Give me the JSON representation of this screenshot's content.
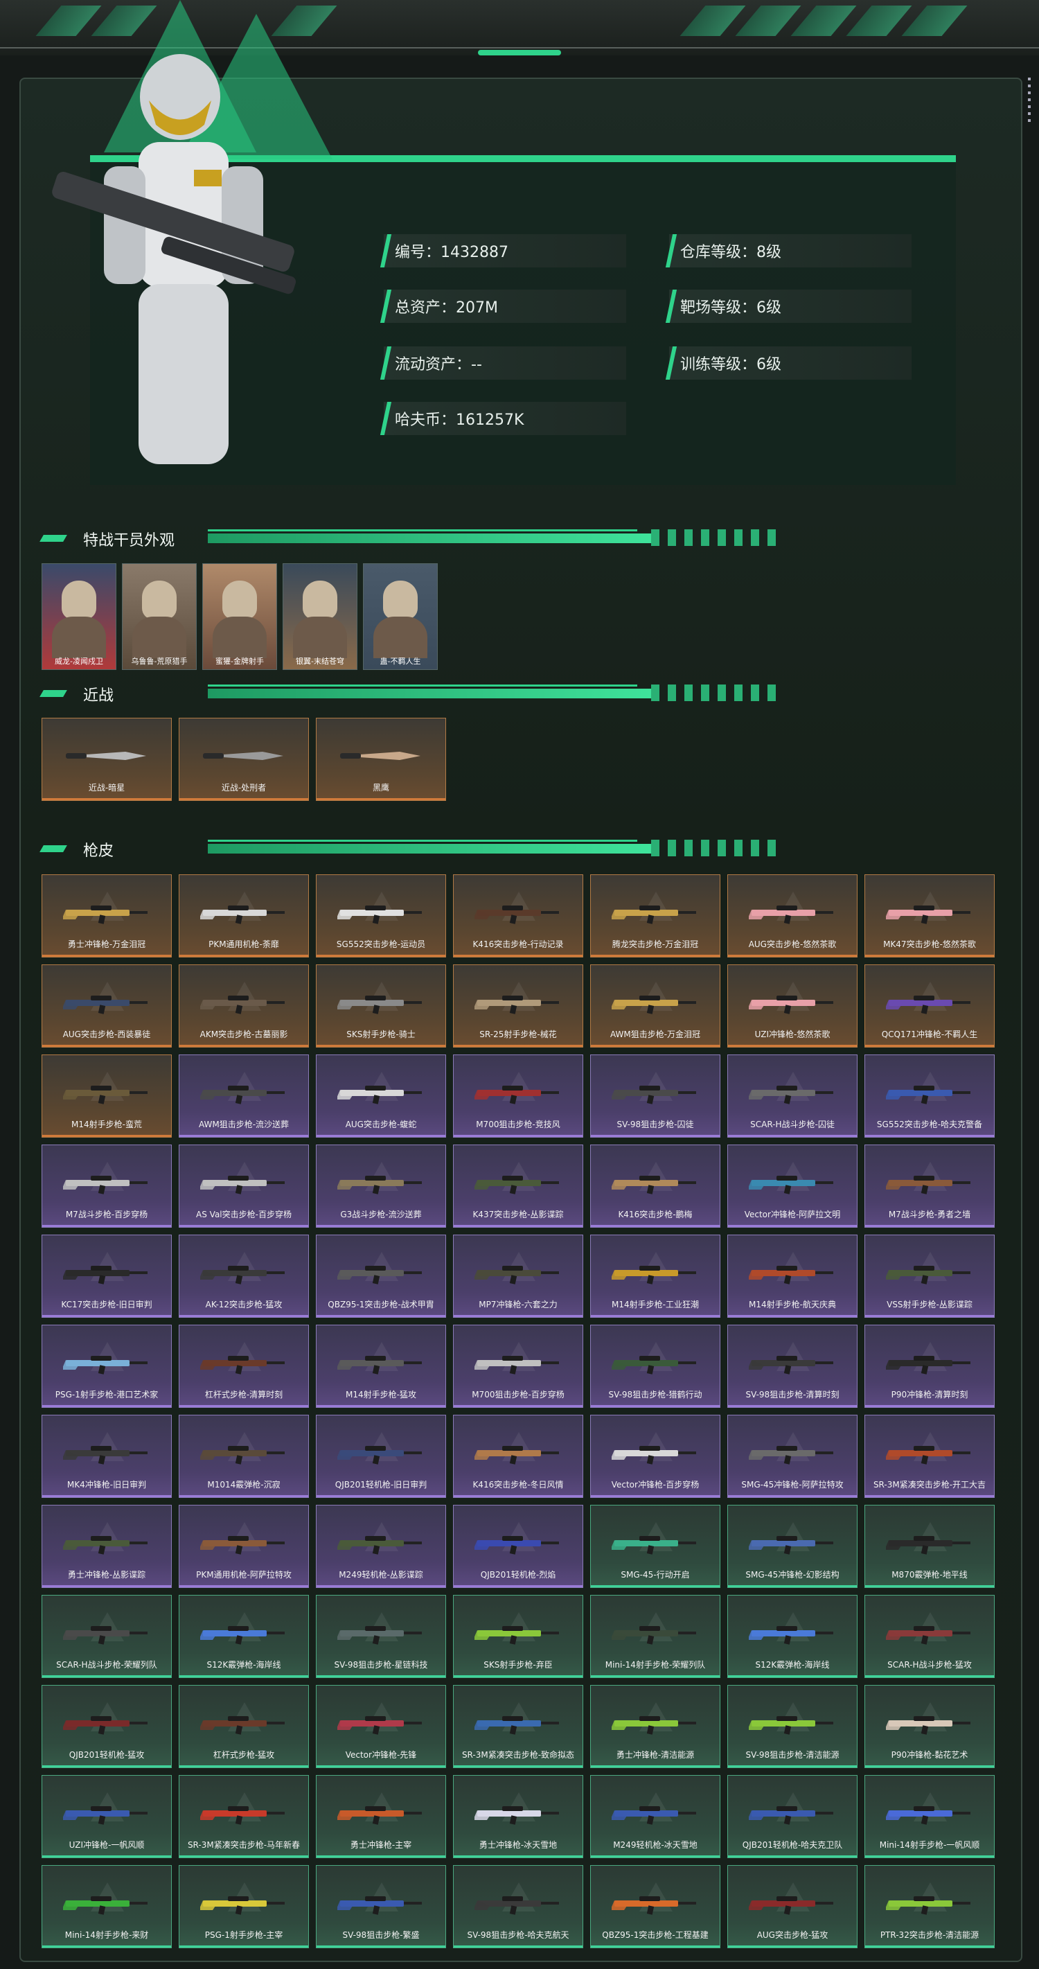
{
  "profile": {
    "id_label": "编号：1432887",
    "total_assets": "总资产：207M",
    "liquid_assets": "流动资产：--",
    "havoc_coins": "哈夫币：161257K",
    "warehouse_level": "仓库等级：8级",
    "range_level": "靶场等级：6级",
    "training_level": "训练等级：6级"
  },
  "sections": {
    "operators": "特战干员外观",
    "melee": "近战",
    "skins": "枪皮"
  },
  "operators": [
    "威龙-凌闻戍卫",
    "乌鲁鲁-荒原猎手",
    "蜜獾-金牌射手",
    "银翼-末结苍穹",
    "蛊-不羁人生"
  ],
  "melee": [
    "近战-暗星",
    "近战-处刑者",
    "黑鹰"
  ],
  "weapon_skins": [
    {
      "label": "勇士冲锋枪-万金泪冠",
      "rarity": "gold",
      "color": "#c8a24a"
    },
    {
      "label": "PKM通用机枪-荼靡",
      "rarity": "gold",
      "color": "#d8d8d8"
    },
    {
      "label": "SG552突击步枪-运动员",
      "rarity": "gold",
      "color": "#e0e0e0"
    },
    {
      "label": "K416突击步枪-行动记录",
      "rarity": "gold",
      "color": "#5a3a2a"
    },
    {
      "label": "腾龙突击步枪-万金泪冠",
      "rarity": "gold",
      "color": "#c8a24a"
    },
    {
      "label": "AUG突击步枪-悠然茶歌",
      "rarity": "gold",
      "color": "#e8a0a8"
    },
    {
      "label": "MK47突击步枪-悠然茶歌",
      "rarity": "gold",
      "color": "#e8a0a8"
    },
    {
      "label": "AUG突击步枪-西装暴徒",
      "rarity": "gold",
      "color": "#3a4a6a"
    },
    {
      "label": "AKM突击步枪-古墓丽影",
      "rarity": "gold",
      "color": "#6a5a4a"
    },
    {
      "label": "SKS射手步枪-骑士",
      "rarity": "gold",
      "color": "#8a8a8a"
    },
    {
      "label": "SR-25射手步枪-械花",
      "rarity": "gold",
      "color": "#b09a7a"
    },
    {
      "label": "AWM狙击步枪-万金泪冠",
      "rarity": "gold",
      "color": "#c8a24a"
    },
    {
      "label": "UZI冲锋枪-悠然茶歌",
      "rarity": "gold",
      "color": "#e8a0a8"
    },
    {
      "label": "QCQ171冲锋枪-不羁人生",
      "rarity": "gold",
      "color": "#6a4ab0"
    },
    {
      "label": "M14射手步枪-蛮荒",
      "rarity": "gold",
      "color": "#6a5a3a"
    },
    {
      "label": "AWM狙击步枪-流沙送葬",
      "rarity": "purple",
      "color": "#4a4a4a"
    },
    {
      "label": "AUG突击步枪-蝮蛇",
      "rarity": "purple",
      "color": "#d8d8d8"
    },
    {
      "label": "M700狙击步枪-竞技风",
      "rarity": "purple",
      "color": "#a03030"
    },
    {
      "label": "SV-98狙击步枪-囚徒",
      "rarity": "purple",
      "color": "#4a4a4a"
    },
    {
      "label": "SCAR-H战斗步枪-囚徒",
      "rarity": "purple",
      "color": "#6a6a6a"
    },
    {
      "label": "SG552突击步枪-哈夫克警备",
      "rarity": "purple",
      "color": "#3a5ab0"
    },
    {
      "label": "M7战斗步枪-百步穿杨",
      "rarity": "purple",
      "color": "#c0c0c0"
    },
    {
      "label": "AS Val突击步枪-百步穿杨",
      "rarity": "purple",
      "color": "#c0c0c0"
    },
    {
      "label": "G3战斗步枪-流沙送葬",
      "rarity": "purple",
      "color": "#8a7a5a"
    },
    {
      "label": "K437突击步枪-丛影谍踪",
      "rarity": "purple",
      "color": "#4a5a3a"
    },
    {
      "label": "K416突击步枪-鹏梅",
      "rarity": "purple",
      "color": "#b08a5a"
    },
    {
      "label": "Vector冲锋枪-阿萨拉文明",
      "rarity": "purple",
      "color": "#3a8ab0"
    },
    {
      "label": "M7战斗步枪-勇者之墙",
      "rarity": "purple",
      "color": "#8a5a3a"
    },
    {
      "label": "KC17突击步枪-旧日审判",
      "rarity": "purple",
      "color": "#2a2a2a"
    },
    {
      "label": "AK-12突击步枪-猛攻",
      "rarity": "purple",
      "color": "#3a3a3a"
    },
    {
      "label": "QBZ95-1突击步枪-战术甲胄",
      "rarity": "purple",
      "color": "#5a5a5a"
    },
    {
      "label": "MP7冲锋枪-六套之力",
      "rarity": "purple",
      "color": "#4a4a3a"
    },
    {
      "label": "M14射手步枪-工业狂潮",
      "rarity": "purple",
      "color": "#c89a2a"
    },
    {
      "label": "M14射手步枪-航天庆典",
      "rarity": "purple",
      "color": "#b04a2a"
    },
    {
      "label": "VSS射手步枪-丛影谍踪",
      "rarity": "purple",
      "color": "#4a5a3a"
    },
    {
      "label": "PSG-1射手步枪-港口艺术家",
      "rarity": "purple",
      "color": "#7ab0d8"
    },
    {
      "label": "杠杆式步枪-清算时刻",
      "rarity": "purple",
      "color": "#6a3a2a"
    },
    {
      "label": "M14射手步枪-猛攻",
      "rarity": "purple",
      "color": "#5a5a5a"
    },
    {
      "label": "M700狙击步枪-百步穿杨",
      "rarity": "purple",
      "color": "#c0c0c0"
    },
    {
      "label": "SV-98狙击步枪-猎鹤行动",
      "rarity": "purple",
      "color": "#3a5a3a"
    },
    {
      "label": "SV-98狙击步枪-清算时刻",
      "rarity": "purple",
      "color": "#3a3a3a"
    },
    {
      "label": "P90冲锋枪-清算时刻",
      "rarity": "purple",
      "color": "#2a2a2a"
    },
    {
      "label": "MK4冲锋枪-旧日审判",
      "rarity": "purple",
      "color": "#3a3a3a"
    },
    {
      "label": "M1014霰弹枪-沉寂",
      "rarity": "purple",
      "color": "#5a4a3a"
    },
    {
      "label": "QJB201轻机枪-旧日审判",
      "rarity": "purple",
      "color": "#3a4a7a"
    },
    {
      "label": "K416突击步枪-冬日风情",
      "rarity": "purple",
      "color": "#b07a4a"
    },
    {
      "label": "Vector冲锋枪-百步穿杨",
      "rarity": "purple",
      "color": "#d8d8d8"
    },
    {
      "label": "SMG-45冲锋枪-阿萨拉特攻",
      "rarity": "purple",
      "color": "#6a6a6a"
    },
    {
      "label": "SR-3M紧凑突击步枪-开工大吉",
      "rarity": "purple",
      "color": "#b04a2a"
    },
    {
      "label": "勇士冲锋枪-丛影谍踪",
      "rarity": "purple",
      "color": "#4a5a3a"
    },
    {
      "label": "PKM通用机枪-阿萨拉特攻",
      "rarity": "purple",
      "color": "#8a5a3a"
    },
    {
      "label": "M249轻机枪-丛影谍踪",
      "rarity": "purple",
      "color": "#4a5a3a"
    },
    {
      "label": "QJB201轻机枪-烈焰",
      "rarity": "purple",
      "color": "#3a4ab0"
    },
    {
      "label": "SMG-45-行动开启",
      "rarity": "green",
      "color": "#3ab08a"
    },
    {
      "label": "SMG-45冲锋枪-幻影结构",
      "rarity": "green",
      "color": "#4a6ab0"
    },
    {
      "label": "M870霰弹枪-地平线",
      "rarity": "green",
      "color": "#2a2a2a"
    },
    {
      "label": "SCAR-H战斗步枪-荣耀列队",
      "rarity": "green",
      "color": "#4a4a4a"
    },
    {
      "label": "S12K霰弹枪-海岸线",
      "rarity": "green",
      "color": "#4a7ad8"
    },
    {
      "label": "SV-98狙击步枪-星链科技",
      "rarity": "green",
      "color": "#5a6a6a"
    },
    {
      "label": "SKS射手步枪-弃臣",
      "rarity": "green",
      "color": "#8ac83a"
    },
    {
      "label": "Mini-14射手步枪-荣耀列队",
      "rarity": "green",
      "color": "#3a4a3a"
    },
    {
      "label": "S12K霰弹枪-海岸线",
      "rarity": "green",
      "color": "#4a7ad8"
    },
    {
      "label": "SCAR-H战斗步枪-猛攻",
      "rarity": "green",
      "color": "#8a3a3a"
    },
    {
      "label": "QJB201轻机枪-猛攻",
      "rarity": "green",
      "color": "#7a2a2a"
    },
    {
      "label": "杠杆式步枪-猛攻",
      "rarity": "green",
      "color": "#6a3a2a"
    },
    {
      "label": "Vector冲锋枪-先锋",
      "rarity": "green",
      "color": "#b03a4a"
    },
    {
      "label": "SR-3M紧凑突击步枪-致命拟态",
      "rarity": "green",
      "color": "#3a6ab0"
    },
    {
      "label": "勇士冲锋枪-清洁能源",
      "rarity": "green",
      "color": "#8ac83a"
    },
    {
      "label": "SV-98狙击步枪-清洁能源",
      "rarity": "green",
      "color": "#8ac83a"
    },
    {
      "label": "P90冲锋枪-黏花艺术",
      "rarity": "green",
      "color": "#d8c8b8"
    },
    {
      "label": "UZI冲锋枪-一帆风顺",
      "rarity": "green",
      "color": "#3a5ab0"
    },
    {
      "label": "SR-3M紧凑突击步枪-马年新春",
      "rarity": "green",
      "color": "#c83a2a"
    },
    {
      "label": "勇士冲锋枪-主宰",
      "rarity": "green",
      "color": "#c85a2a"
    },
    {
      "label": "勇士冲锋枪-冰天雪地",
      "rarity": "green",
      "color": "#d8d8e8"
    },
    {
      "label": "M249轻机枪-冰天雪地",
      "rarity": "green",
      "color": "#3a5ab0"
    },
    {
      "label": "QJB201轻机枪-哈夫克卫队",
      "rarity": "green",
      "color": "#3a5ab0"
    },
    {
      "label": "Mini-14射手步枪-一帆风顺",
      "rarity": "green",
      "color": "#4a6ad8"
    },
    {
      "label": "Mini-14射手步枪-来财",
      "rarity": "green",
      "color": "#3ab03a"
    },
    {
      "label": "PSG-1射手步枪-主宰",
      "rarity": "green",
      "color": "#d8c83a"
    },
    {
      "label": "SV-98狙击步枪-繁盛",
      "rarity": "green",
      "color": "#3a5ab0"
    },
    {
      "label": "SV-98狙击步枪-哈夫克航天",
      "rarity": "green",
      "color": "#3a3a3a"
    },
    {
      "label": "QBZ95-1突击步枪-工程基建",
      "rarity": "green",
      "color": "#d86a2a"
    },
    {
      "label": "AUG突击步枪-猛攻",
      "rarity": "green",
      "color": "#8a2a2a"
    },
    {
      "label": "PTR-32突击步枪-清洁能源",
      "rarity": "green",
      "color": "#8ac83a"
    }
  ]
}
